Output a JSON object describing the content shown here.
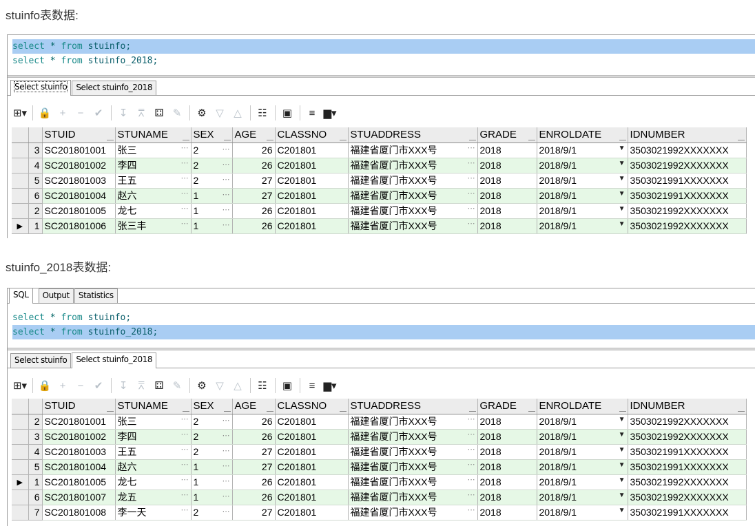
{
  "captions": {
    "first": "stuinfo表数据:",
    "second": "stuinfo_2018表数据:"
  },
  "panel1": {
    "sql_lines": [
      {
        "kw1": "select",
        "op": " * ",
        "kw2": "from",
        "table": " stuinfo;"
      },
      {
        "kw1": "select",
        "op": " * ",
        "kw2": "from",
        "table": " stuinfo_2018;"
      }
    ],
    "tabs": [
      "Select stuinfo",
      "Select stuinfo_2018"
    ]
  },
  "panel2": {
    "top_tabs": [
      "SQL",
      "Output",
      "Statistics"
    ],
    "sql_lines": [
      {
        "kw1": "select",
        "op": " * ",
        "kw2": "from",
        "table": " stuinfo;"
      },
      {
        "kw1": "select",
        "op": " * ",
        "kw2": "from",
        "table": " stuinfo_2018;"
      }
    ],
    "tabs": [
      "Select stuinfo",
      "Select stuinfo_2018"
    ]
  },
  "toolbar_icons": [
    "grid-icon",
    "lock-icon",
    "plus-icon",
    "minus-icon",
    "check-icon",
    "filter-down-icon",
    "filter-icon",
    "binoculars-icon",
    "eraser-icon",
    "query-icon",
    "arrow-down-icon",
    "arrow-up-icon",
    "tree-icon",
    "save-icon",
    "database-icon",
    "chart-icon"
  ],
  "columns": [
    "STUID",
    "STUNAME",
    "SEX",
    "AGE",
    "CLASSNO",
    "STUADDRESS",
    "GRADE",
    "ENROLDATE",
    "IDNUMBER"
  ],
  "table1": [
    {
      "idx": "3",
      "STUID": "SC201801001",
      "STUNAME": "张三",
      "SEX": "2",
      "AGE": "26",
      "CLASSNO": "C201801",
      "STUADDRESS": "福建省厦门市XXX号",
      "GRADE": "2018",
      "ENROLDATE": "2018/9/1",
      "IDNUMBER": "3503021992XXXXXXX"
    },
    {
      "idx": "4",
      "STUID": "SC201801002",
      "STUNAME": "李四",
      "SEX": "2",
      "AGE": "26",
      "CLASSNO": "C201801",
      "STUADDRESS": "福建省厦门市XXX号",
      "GRADE": "2018",
      "ENROLDATE": "2018/9/1",
      "IDNUMBER": "3503021992XXXXXXX"
    },
    {
      "idx": "5",
      "STUID": "SC201801003",
      "STUNAME": "王五",
      "SEX": "2",
      "AGE": "27",
      "CLASSNO": "C201801",
      "STUADDRESS": "福建省厦门市XXX号",
      "GRADE": "2018",
      "ENROLDATE": "2018/9/1",
      "IDNUMBER": "3503021991XXXXXXX"
    },
    {
      "idx": "6",
      "STUID": "SC201801004",
      "STUNAME": "赵六",
      "SEX": "1",
      "AGE": "27",
      "CLASSNO": "C201801",
      "STUADDRESS": "福建省厦门市XXX号",
      "GRADE": "2018",
      "ENROLDATE": "2018/9/1",
      "IDNUMBER": "3503021991XXXXXXX"
    },
    {
      "idx": "2",
      "STUID": "SC201801005",
      "STUNAME": "龙七",
      "SEX": "1",
      "AGE": "26",
      "CLASSNO": "C201801",
      "STUADDRESS": "福建省厦门市XXX号",
      "GRADE": "2018",
      "ENROLDATE": "2018/9/1",
      "IDNUMBER": "3503021992XXXXXXX"
    },
    {
      "idx": "1",
      "STUID": "SC201801006",
      "STUNAME": "张三丰",
      "SEX": "1",
      "AGE": "26",
      "CLASSNO": "C201801",
      "STUADDRESS": "福建省厦门市XXX号",
      "GRADE": "2018",
      "ENROLDATE": "2018/9/1",
      "IDNUMBER": "3503021992XXXXXXX"
    }
  ],
  "table2": [
    {
      "idx": "2",
      "STUID": "SC201801001",
      "STUNAME": "张三",
      "SEX": "2",
      "AGE": "26",
      "CLASSNO": "C201801",
      "STUADDRESS": "福建省厦门市XXX号",
      "GRADE": "2018",
      "ENROLDATE": "2018/9/1",
      "IDNUMBER": "3503021992XXXXXXX"
    },
    {
      "idx": "3",
      "STUID": "SC201801002",
      "STUNAME": "李四",
      "SEX": "2",
      "AGE": "26",
      "CLASSNO": "C201801",
      "STUADDRESS": "福建省厦门市XXX号",
      "GRADE": "2018",
      "ENROLDATE": "2018/9/1",
      "IDNUMBER": "3503021992XXXXXXX"
    },
    {
      "idx": "4",
      "STUID": "SC201801003",
      "STUNAME": "王五",
      "SEX": "2",
      "AGE": "27",
      "CLASSNO": "C201801",
      "STUADDRESS": "福建省厦门市XXX号",
      "GRADE": "2018",
      "ENROLDATE": "2018/9/1",
      "IDNUMBER": "3503021991XXXXXXX"
    },
    {
      "idx": "5",
      "STUID": "SC201801004",
      "STUNAME": "赵六",
      "SEX": "1",
      "AGE": "27",
      "CLASSNO": "C201801",
      "STUADDRESS": "福建省厦门市XXX号",
      "GRADE": "2018",
      "ENROLDATE": "2018/9/1",
      "IDNUMBER": "3503021991XXXXXXX"
    },
    {
      "idx": "1",
      "STUID": "SC201801005",
      "STUNAME": "龙七",
      "SEX": "1",
      "AGE": "26",
      "CLASSNO": "C201801",
      "STUADDRESS": "福建省厦门市XXX号",
      "GRADE": "2018",
      "ENROLDATE": "2018/9/1",
      "IDNUMBER": "3503021992XXXXXXX"
    },
    {
      "idx": "6",
      "STUID": "SC201801007",
      "STUNAME": "龙五",
      "SEX": "1",
      "AGE": "26",
      "CLASSNO": "C201801",
      "STUADDRESS": "福建省厦门市XXX号",
      "GRADE": "2018",
      "ENROLDATE": "2018/9/1",
      "IDNUMBER": "3503021992XXXXXXX"
    },
    {
      "idx": "7",
      "STUID": "SC201801008",
      "STUNAME": "李一天",
      "SEX": "2",
      "AGE": "27",
      "CLASSNO": "C201801",
      "STUADDRESS": "福建省厦门市XXX号",
      "GRADE": "2018",
      "ENROLDATE": "2018/9/1",
      "IDNUMBER": "3503021991XXXXXXX"
    }
  ]
}
